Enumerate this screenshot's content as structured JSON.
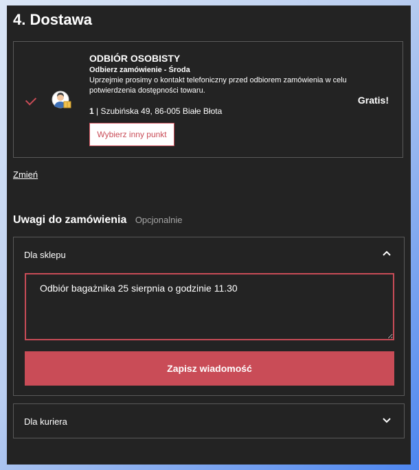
{
  "section": {
    "title": "4. Dostawa"
  },
  "delivery": {
    "method_title": "ODBIÓR OSOBISTY",
    "pickup_day": "Odbierz zamówienie - Środa",
    "note": "Uprzejmie prosimy o kontakt telefoniczny przed odbiorem zamówienia w celu potwierdzenia dostępności towaru.",
    "point_number": "1",
    "address": "| Szubińska 49, 86-005 Białe Błota",
    "choose_other_label": "Wybierz inny punkt",
    "price": "Gratis!",
    "icons": {
      "selected": "check-icon",
      "method": "person-package-icon"
    }
  },
  "change_link": "Zmień",
  "order_notes": {
    "title": "Uwagi do zamówienia",
    "optional": "Opcjonalnie",
    "shop": {
      "label": "Dla sklepu",
      "message": "Odbiór bagażnika 25 sierpnia o godzinie 11.30",
      "save_label": "Zapisz wiadomość",
      "expanded": true
    },
    "courier": {
      "label": "Dla kuriera",
      "expanded": false
    }
  },
  "colors": {
    "panel_bg": "#232323",
    "accent": "#c94c57",
    "border": "#5a5a5a",
    "muted_text": "#a6a6a6"
  }
}
